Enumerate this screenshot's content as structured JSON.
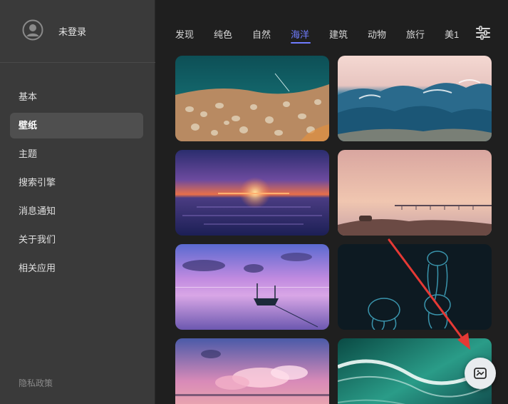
{
  "sidebar": {
    "user": {
      "name": "未登录"
    },
    "items": [
      {
        "label": "基本"
      },
      {
        "label": "壁纸",
        "active": true
      },
      {
        "label": "主题"
      },
      {
        "label": "搜索引擎"
      },
      {
        "label": "消息通知"
      },
      {
        "label": "关于我们"
      },
      {
        "label": "相关应用"
      }
    ],
    "privacy_label": "隐私政策"
  },
  "tabs": {
    "items": [
      {
        "label": "发现"
      },
      {
        "label": "纯色"
      },
      {
        "label": "自然"
      },
      {
        "label": "海洋",
        "active": true
      },
      {
        "label": "建筑"
      },
      {
        "label": "动物"
      },
      {
        "label": "旅行"
      },
      {
        "label": "美1"
      }
    ],
    "filter_icon": "sliders-icon"
  },
  "wallpapers": [
    {
      "name": "ocean-pebbles"
    },
    {
      "name": "ocean-waves-dusk"
    },
    {
      "name": "ocean-sunset-purple"
    },
    {
      "name": "pier-pink-sky"
    },
    {
      "name": "boat-purple-lake"
    },
    {
      "name": "jellyfish-dark"
    },
    {
      "name": "pink-clouds-sea"
    },
    {
      "name": "aerial-green-wave"
    }
  ],
  "fab": {
    "icon": "wallpaper-switch-icon"
  },
  "colors": {
    "accent": "#6f7cff",
    "sidebar_bg": "#3a3a3a",
    "main_bg": "#1f1f1f",
    "annotation_arrow": "#e53935"
  }
}
